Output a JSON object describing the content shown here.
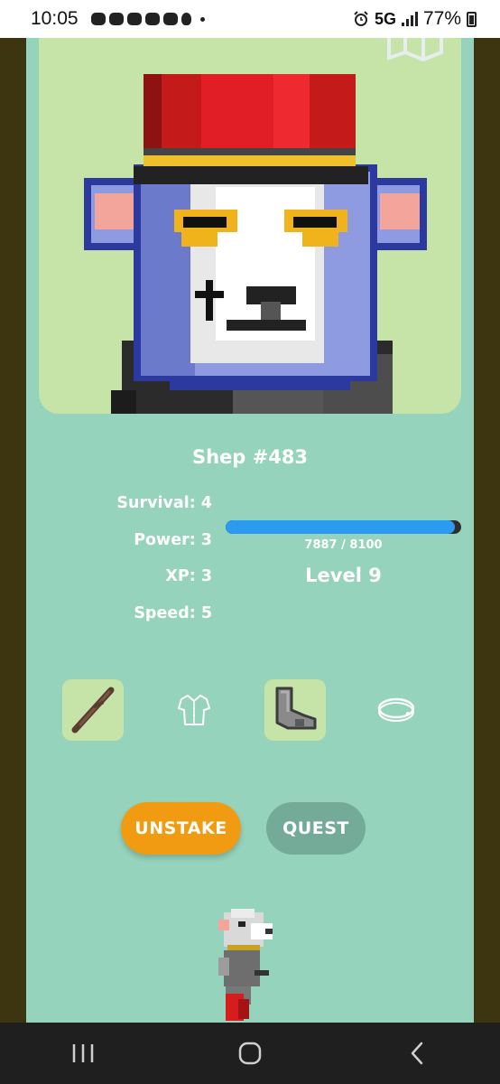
{
  "status_bar": {
    "time": "10:05",
    "network": "5G",
    "battery": "77%"
  },
  "character": {
    "name": "Shep #483"
  },
  "stats": [
    {
      "label": "Survival: 4"
    },
    {
      "label": "Power: 3"
    },
    {
      "label": "XP: 3"
    },
    {
      "label": "Speed: 5"
    }
  ],
  "progress": {
    "current": 7887,
    "max": 8100,
    "text": "7887 / 8100",
    "level_text": "Level 9"
  },
  "equipment": [
    {
      "slot": "weapon",
      "icon": "stick-icon",
      "equipped": true
    },
    {
      "slot": "shirt",
      "icon": "shirt-icon",
      "equipped": false
    },
    {
      "slot": "boots",
      "icon": "boots-icon",
      "equipped": true
    },
    {
      "slot": "collar",
      "icon": "collar-icon",
      "equipped": false
    }
  ],
  "actions": {
    "unstake_label": "UNSTAKE",
    "quest_label": "QUEST"
  },
  "colors": {
    "panel": "#95d3bc",
    "hero_bg": "#c6e3a8",
    "unstake": "#f09b11",
    "quest": "#74ab98",
    "xp_fill": "#2a9bf0",
    "frame": "#3d3510"
  }
}
